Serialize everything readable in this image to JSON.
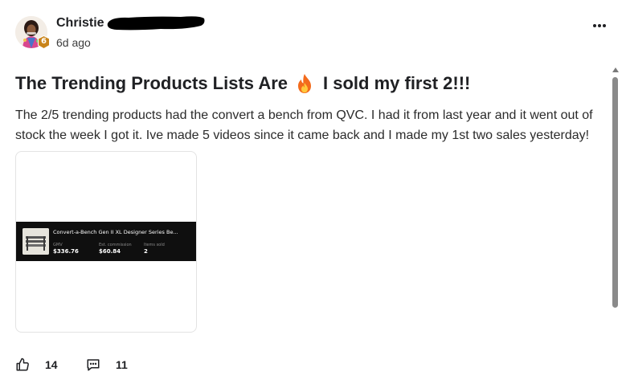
{
  "author": {
    "name": "Christie",
    "level": "6"
  },
  "post": {
    "time": "6d ago",
    "title_before": "The Trending Products Lists Are",
    "title_after": "I sold my first 2!!!",
    "body": "The 2/5 trending products had the convert a bench from QVC. I had it from last year and it went out of stock the week I got it. Ive made 5 videos since it came back and I made my 1st two sales yesterday!"
  },
  "attachment": {
    "product_title": "Convert-a-Bench Gen II XL Designer Series Be...",
    "stats": [
      {
        "label": "GMV",
        "value": "$336.76"
      },
      {
        "label": "Est. commission",
        "value": "$60.84"
      },
      {
        "label": "Items sold",
        "value": "2"
      }
    ]
  },
  "actions": {
    "likes": "14",
    "comments": "11"
  },
  "colors": {
    "level_badge": "#c9841a",
    "redaction": "#000000",
    "strip": "#0f0f0f"
  },
  "icons": {
    "like": "thumbs-up-icon",
    "comment": "comment-icon",
    "more": "more-dots-icon",
    "fire": "fire-emoji-icon"
  }
}
